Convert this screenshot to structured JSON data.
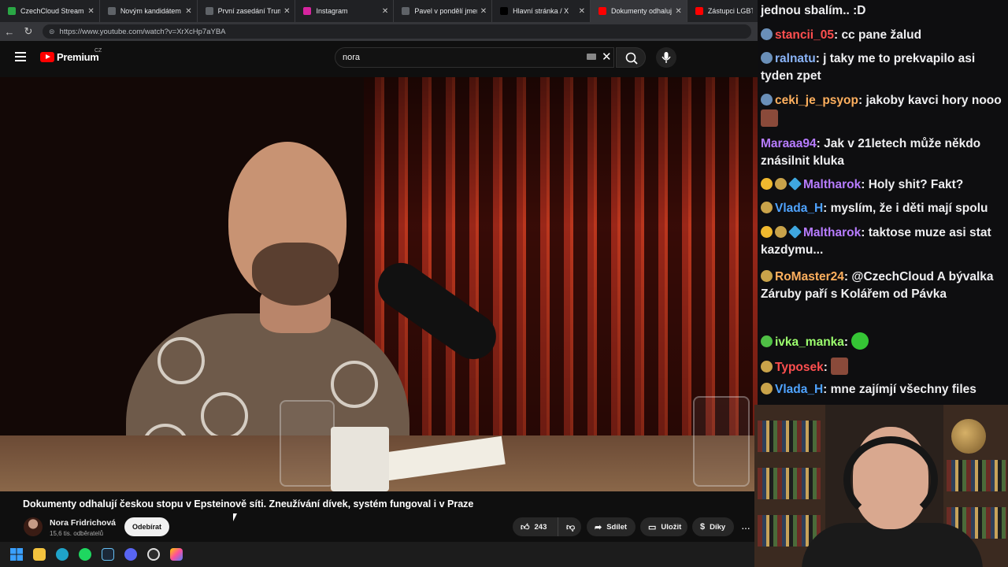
{
  "browser": {
    "tabs": [
      {
        "title": "CzechCloud Stream - Wa",
        "color": "#2aa745",
        "active": false
      },
      {
        "title": "Novým kandidátem na r",
        "color": "#5f6368",
        "active": false
      },
      {
        "title": "První zasedání Trump",
        "color": "#5f6368",
        "active": false
      },
      {
        "title": "Instagram",
        "color": "#d6249f",
        "active": false
      },
      {
        "title": "Pavel v pondělí jmenu",
        "color": "#5f6368",
        "active": false
      },
      {
        "title": "Hlavní stránka / X",
        "color": "#000000",
        "active": false
      },
      {
        "title": "Dokumenty odhalují čes",
        "color": "#ff0000",
        "active": true
      },
      {
        "title": "Zástupci LGBT a",
        "color": "#ff0000",
        "active": false
      }
    ],
    "url": "https://www.youtube.com/watch?v=XrXcHp7aYBA"
  },
  "youtube": {
    "logo_text": "Premium",
    "region": "CZ",
    "search_value": "nora",
    "video_title": "Dokumenty odhalují českou stopu v Epsteinově síti. Zneužívání dívek, systém fungoval i v Praze",
    "channel_name": "Nora Fridrichová",
    "subscribers": "15,6 tis. odběratelů",
    "subscribe_label": "Odebírat",
    "likes": "243",
    "share_label": "Sdílet",
    "save_label": "Uložit",
    "thanks_label": "Díky",
    "accent": "#ff0000"
  },
  "chat": {
    "top_fragment": "jednou sbalím.. :D",
    "messages": [
      {
        "user": "stancii_05",
        "color": "#ff4f4f",
        "text": "cc pane žalud",
        "badges": [
          "sword"
        ]
      },
      {
        "user": "ralnatu",
        "color": "#8ab4f8",
        "text": "j taky me to prekvapilo asi tyden zpet",
        "badges": [
          "sword"
        ]
      },
      {
        "user": "ceki_je_psyop",
        "color": "#ffb05e",
        "text": "jakoby kavci hory nooo",
        "badges": [
          "sword"
        ],
        "emote": "face-emote"
      },
      {
        "user": "Maraaa94",
        "color": "#b77cff",
        "text": "Jak v 21letech může někdo znásilnit kluka",
        "badges": []
      },
      {
        "user": "Maltharok",
        "color": "#b77cff",
        "text": "Holy shit? Fakt?",
        "badges": [
          "coin",
          "sword",
          "cube"
        ]
      },
      {
        "user": "Vlada_H",
        "color": "#4fa3ff",
        "text": "myslím, že i děti mají spolu",
        "badges": [
          "sword"
        ]
      },
      {
        "user": "Maltharok",
        "color": "#b77cff",
        "text": "taktose muze asi stat kazdymu...",
        "badges": [
          "coin",
          "sword",
          "cube"
        ]
      },
      {
        "user": "RoMaster24",
        "color": "#ffb05e",
        "text": "@CzechCloud A bývalka Záruby paří s Kolářem od Pávka",
        "badges": [
          "sword"
        ]
      },
      {
        "user": "ivka_manka",
        "color": "#9cff6e",
        "text": "",
        "badges": [
          "sword"
        ],
        "emote": "green-emote"
      },
      {
        "user": "Typosek",
        "color": "#ff4f4f",
        "text": "",
        "badges": [
          "sword"
        ],
        "emote": "face-emote"
      },
      {
        "user": "Vlada_H",
        "color": "#4fa3ff",
        "text": "mne zajímjí všechny files",
        "badges": [
          "sword"
        ]
      }
    ]
  }
}
